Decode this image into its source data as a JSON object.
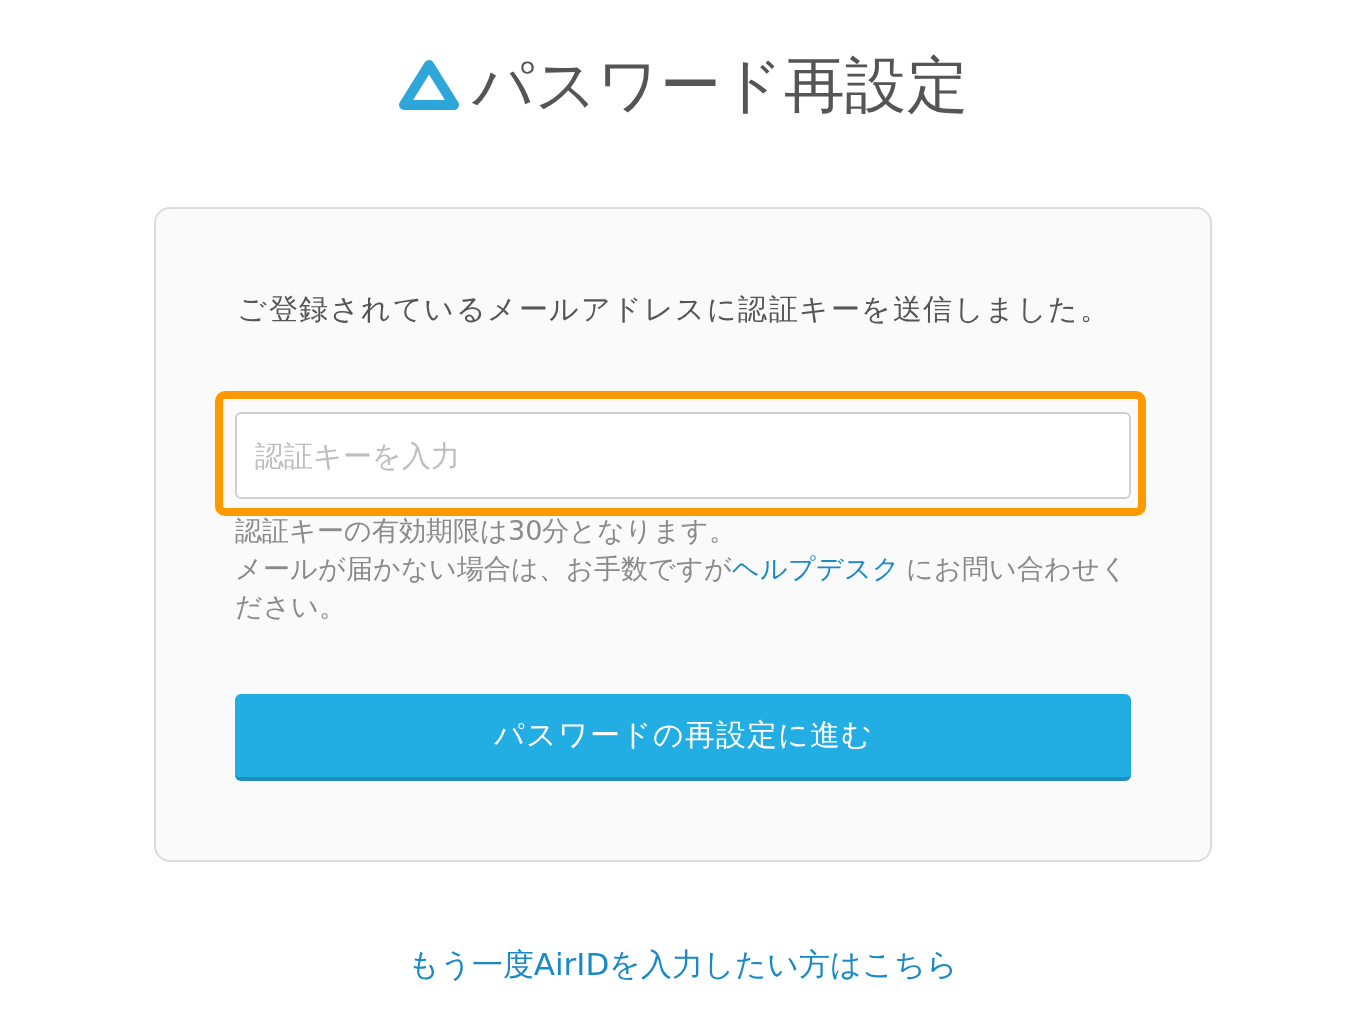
{
  "header": {
    "title": "パスワード再設定"
  },
  "card": {
    "message": "ご登録されているメールアドレスに認証キーを送信しました。",
    "key_input": {
      "placeholder": "認証キーを入力",
      "highlighted": true
    },
    "validity_note": "認証キーの有効期限は30分となります。",
    "help_note": {
      "before": "メールが届かない場合は、お手数ですが",
      "link": "ヘルプデスク",
      "after": "にお問い合わせください。"
    },
    "submit_button": {
      "label": "パスワードの再設定に進む"
    }
  },
  "retry_link": {
    "label": "もう一度AirIDを入力したい方はこちら"
  }
}
